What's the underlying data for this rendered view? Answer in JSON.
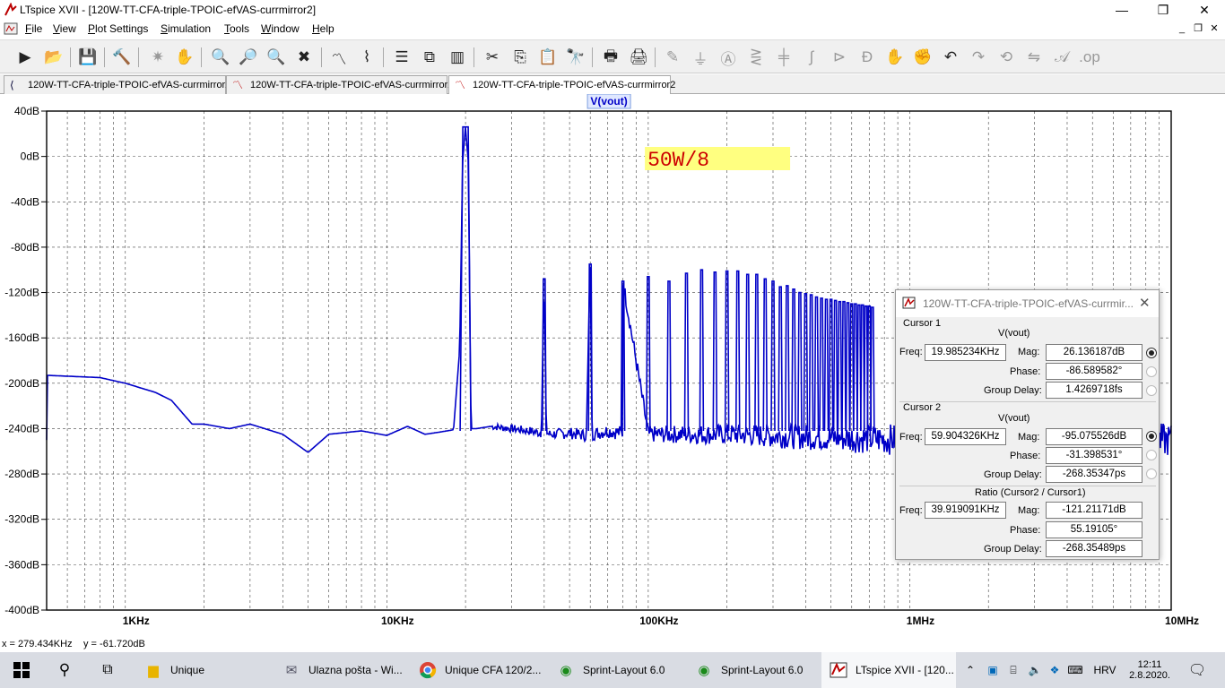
{
  "window": {
    "title": "LTspice XVII - [120W-TT-CFA-triple-TPOIC-efVAS-currmirror2]",
    "minimize_glyph": "—",
    "restore_glyph": "❐",
    "close_glyph": "✕"
  },
  "menu": [
    "File",
    "View",
    "Plot Settings",
    "Simulation",
    "Tools",
    "Window",
    "Help"
  ],
  "mdi_controls": {
    "minimize": "_",
    "restore": "❐",
    "close": "✕"
  },
  "toolbar_icons": [
    "run",
    "open",
    "save",
    "control-panel",
    "halt",
    "pan",
    "zoom-in",
    "zoom-out",
    "zoom-fit",
    "zoom-cancel",
    "autorange",
    "cursor-measure",
    "tile-horizontal",
    "cascade",
    "tile-vertical",
    "cut",
    "copy",
    "paste",
    "find",
    "print-setup",
    "print",
    "wire",
    "ground",
    "label",
    "resistor",
    "capacitor",
    "inductor",
    "diode",
    "component",
    "move",
    "drag",
    "undo",
    "redo",
    "rotate",
    "mirror",
    "text",
    "spice-directive"
  ],
  "tabs": [
    {
      "label": "120W-TT-CFA-triple-TPOIC-efVAS-currmirror2",
      "icon": "schematic-icon",
      "active": false
    },
    {
      "label": "120W-TT-CFA-triple-TPOIC-efVAS-currmirror2",
      "icon": "waveform-icon",
      "active": false
    },
    {
      "label": "120W-TT-CFA-triple-TPOIC-efVAS-currmirror2",
      "icon": "waveform-icon",
      "active": true
    }
  ],
  "chart_data": {
    "type": "line",
    "title": "V(vout)",
    "x_scale": "log",
    "xlim": [
      500,
      10000000
    ],
    "ylim": [
      -400,
      40
    ],
    "y_ticks": [
      "40dB",
      "0dB",
      "-40dB",
      "-80dB",
      "-120dB",
      "-160dB",
      "-200dB",
      "-240dB",
      "-280dB",
      "-320dB",
      "-360dB",
      "-400dB"
    ],
    "x_ticks": [
      "1KHz",
      "10KHz",
      "100KHz",
      "1MHz",
      "10MHz"
    ],
    "grid": true,
    "grid_style": "dashed",
    "series_color": "#0000c8",
    "annotation": {
      "text": "50W/8",
      "color": "#cc0000",
      "background": "#ffff80"
    },
    "series": [
      {
        "name": "V(vout)",
        "x": [
          500,
          800,
          1000,
          1300,
          1500,
          1800,
          2000,
          2500,
          3000,
          4000,
          5000,
          6000,
          8000,
          10000,
          12000,
          14000,
          16000,
          18000,
          19000,
          19500,
          19985,
          20500,
          21000,
          22000,
          25000,
          30000,
          35000,
          39000,
          39904,
          40800,
          42000,
          50000,
          58000,
          59904,
          61000,
          70000,
          79800,
          80000,
          100000,
          200000,
          500000,
          1000000,
          2000000,
          5000000,
          10000000
        ],
        "y": [
          -193,
          -195,
          -200,
          -208,
          -215,
          -236,
          -236,
          -240,
          -236,
          -245,
          -261,
          -245,
          -242,
          -246,
          -238,
          -245,
          -243,
          -241,
          -170,
          -5,
          26,
          -5,
          -240,
          -240,
          -238,
          -240,
          -242,
          -244,
          -108,
          -244,
          -245,
          -244,
          -246,
          -95,
          -245,
          -242,
          -244,
          -110,
          -245,
          -245,
          -248,
          -250,
          -250,
          -252,
          -250
        ]
      }
    ],
    "harmonics": [
      {
        "f": 20000,
        "y": 26
      },
      {
        "f": 40000,
        "y": -108
      },
      {
        "f": 60000,
        "y": -95
      },
      {
        "f": 80000,
        "y": -110
      },
      {
        "f": 100000,
        "y": -106
      },
      {
        "f": 120000,
        "y": -110
      },
      {
        "f": 140000,
        "y": -103
      },
      {
        "f": 160000,
        "y": -100
      },
      {
        "f": 180000,
        "y": -102
      },
      {
        "f": 200000,
        "y": -101
      },
      {
        "f": 220000,
        "y": -101
      },
      {
        "f": 240000,
        "y": -104
      },
      {
        "f": 260000,
        "y": -104
      },
      {
        "f": 280000,
        "y": -108
      },
      {
        "f": 300000,
        "y": -110
      },
      {
        "f": 320000,
        "y": -115
      },
      {
        "f": 340000,
        "y": -114
      },
      {
        "f": 360000,
        "y": -117
      },
      {
        "f": 380000,
        "y": -120
      },
      {
        "f": 400000,
        "y": -121
      },
      {
        "f": 420000,
        "y": -122
      },
      {
        "f": 440000,
        "y": -124
      },
      {
        "f": 460000,
        "y": -125
      },
      {
        "f": 480000,
        "y": -126
      },
      {
        "f": 500000,
        "y": -126
      },
      {
        "f": 520000,
        "y": -127
      },
      {
        "f": 540000,
        "y": -128
      },
      {
        "f": 560000,
        "y": -128
      },
      {
        "f": 580000,
        "y": -129
      },
      {
        "f": 600000,
        "y": -130
      },
      {
        "f": 620000,
        "y": -130
      },
      {
        "f": 640000,
        "y": -131
      },
      {
        "f": 660000,
        "y": -131
      },
      {
        "f": 680000,
        "y": -132
      },
      {
        "f": 700000,
        "y": -132
      },
      {
        "f": 720000,
        "y": -133
      }
    ]
  },
  "status": {
    "x": "x = 279.434KHz",
    "y": "y = -61.720dB"
  },
  "cursor_dialog": {
    "title": "120W-TT-CFA-triple-TPOIC-efVAS-currmir...",
    "cursor1": {
      "header": "Cursor 1",
      "trace": "V(vout)",
      "freq_label": "Freq:",
      "freq": "19.985234KHz",
      "mag_label": "Mag:",
      "mag": "26.136187dB",
      "phase_label": "Phase:",
      "phase": "-86.589582°",
      "gd_label": "Group Delay:",
      "gd": "1.4269718fs"
    },
    "cursor2": {
      "header": "Cursor 2",
      "trace": "V(vout)",
      "freq_label": "Freq:",
      "freq": "59.904326KHz",
      "mag_label": "Mag:",
      "mag": "-95.075526dB",
      "phase_label": "Phase:",
      "phase": "-31.398531°",
      "gd_label": "Group Delay:",
      "gd": "-268.35347ps"
    },
    "ratio": {
      "header": "Ratio (Cursor2 / Cursor1)",
      "freq_label": "Freq:",
      "freq": "39.919091KHz",
      "mag_label": "Mag:",
      "mag": "-121.21171dB",
      "phase_label": "Phase:",
      "phase": "55.19105°",
      "gd_label": "Group Delay:",
      "gd": "-268.35489ps"
    }
  },
  "taskbar": {
    "items": [
      {
        "label": "Unique",
        "icon": "folder-icon"
      },
      {
        "label": "Ulazna pošta - Wi...",
        "icon": "mail-icon"
      },
      {
        "label": "Unique CFA 120/2...",
        "icon": "chrome-icon"
      },
      {
        "label": "Sprint-Layout 6.0",
        "icon": "sprint-layout-icon"
      },
      {
        "label": "Sprint-Layout 6.0",
        "icon": "sprint-layout-icon"
      },
      {
        "label": "LTspice XVII - [120...",
        "icon": "ltspice-icon"
      }
    ],
    "lang": "HRV",
    "time": "12:11",
    "date": "2.8.2020."
  }
}
